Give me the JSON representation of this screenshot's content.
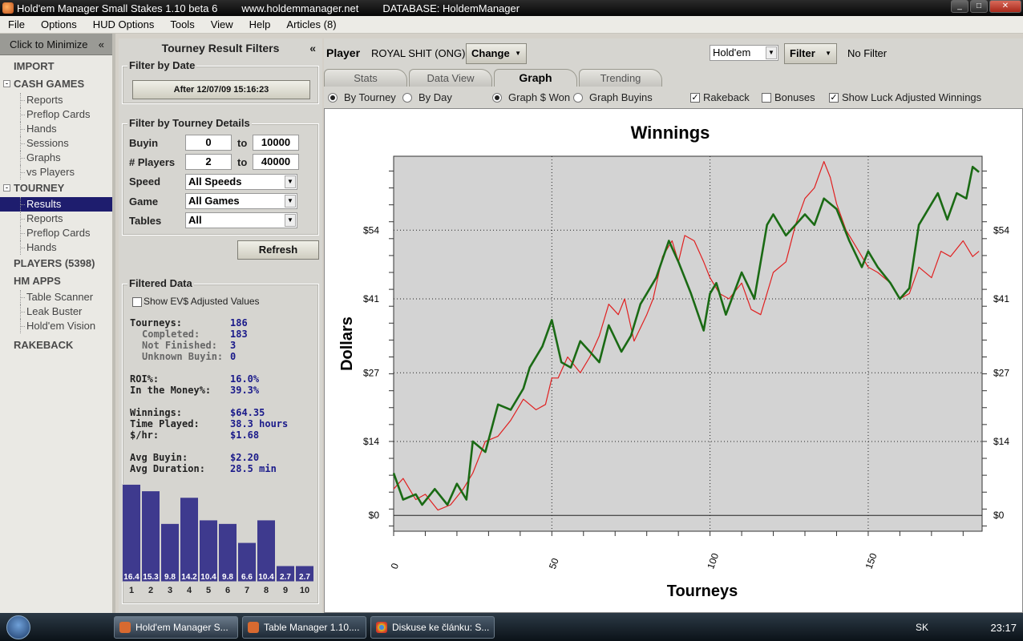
{
  "window": {
    "title": "Hold'em Manager Small Stakes 1.10 beta 6",
    "url": "www.holdemmanager.net",
    "database": "DATABASE: HoldemManager"
  },
  "menu": [
    "File",
    "Options",
    "HUD Options",
    "Tools",
    "View",
    "Help",
    "Articles (8)"
  ],
  "nav": {
    "minimize_label": "Click to Minimize",
    "minimize_arrow": "«",
    "import": "IMPORT",
    "cash_games": "CASH GAMES",
    "cash_items": [
      "Reports",
      "Preflop Cards",
      "Hands",
      "Sessions",
      "Graphs",
      "vs Players"
    ],
    "tourney": "TOURNEY",
    "tourney_items": [
      "Results",
      "Reports",
      "Preflop Cards",
      "Hands"
    ],
    "players": "PLAYERS (5398)",
    "hm_apps": "HM APPS",
    "apps_items": [
      "Table Scanner",
      "Leak Buster",
      "Hold'em Vision"
    ],
    "rakeback": "RAKEBACK",
    "toggle_open": "-"
  },
  "filters": {
    "title": "Tourney Result Filters",
    "collapse": "«",
    "by_date": "Filter by Date",
    "date_button": "After 12/07/09 15:16:23",
    "by_details": "Filter by Tourney Details",
    "buyin_label": "Buyin",
    "buyin_from": "0",
    "buyin_to": "10000",
    "to": "to",
    "players_label": "# Players",
    "players_from": "2",
    "players_to": "40000",
    "speed_label": "Speed",
    "speed_value": "All Speeds",
    "game_label": "Game",
    "game_value": "All Games",
    "tables_label": "Tables",
    "tables_value": "All",
    "refresh": "Refresh"
  },
  "filtered": {
    "title": "Filtered Data",
    "ev_label": "Show EV$ Adjusted Values",
    "stats": [
      {
        "label": "Tourneys:",
        "value": "186",
        "sub": false
      },
      {
        "label": "Completed:",
        "value": "183",
        "sub": true
      },
      {
        "label": "Not Finished:",
        "value": "3",
        "sub": true
      },
      {
        "label": "Unknown Buyin:",
        "value": "0",
        "sub": true
      },
      {
        "label": "ROI%:",
        "value": "16.0%",
        "sub": false,
        "gap": true
      },
      {
        "label": "In the Money%:",
        "value": "39.3%",
        "sub": false
      },
      {
        "label": "Winnings:",
        "value": "$64.35",
        "sub": false,
        "gap": true
      },
      {
        "label": "Time Played:",
        "value": "38.3 hours",
        "sub": false
      },
      {
        "label": "$/hr:",
        "value": "$1.68",
        "sub": false
      },
      {
        "label": "Avg Buyin:",
        "value": "$2.20",
        "sub": false,
        "gap": true
      },
      {
        "label": "Avg Duration:",
        "value": "28.5 min",
        "sub": false
      }
    ],
    "histogram": {
      "labels": [
        "1",
        "2",
        "3",
        "4",
        "5",
        "6",
        "7",
        "8",
        "9",
        "10"
      ],
      "values": [
        16.4,
        15.3,
        9.8,
        14.2,
        10.4,
        9.8,
        6.6,
        10.4,
        2.7,
        2.7
      ],
      "value_labels": [
        "16.4",
        "15.3",
        "9.8",
        "14.2",
        "10.4",
        "9.8",
        "6.6",
        "10.4",
        "2.7",
        "2.7"
      ],
      "max": 17,
      "color": "#3e3a8e"
    }
  },
  "player_bar": {
    "label": "Player",
    "name": "ROYAL SHIT (ONG)",
    "change": "Change",
    "game": "Hold'em",
    "filter": "Filter",
    "no_filter": "No Filter"
  },
  "tabs": [
    {
      "label": "Stats"
    },
    {
      "label": "Data View"
    },
    {
      "label": "Graph",
      "active": true
    },
    {
      "label": "Trending"
    }
  ],
  "options": {
    "by_tourney": "By Tourney",
    "by_day": "By Day",
    "graph_won": "Graph $ Won",
    "graph_buyins": "Graph Buyins",
    "rakeback": "Rakeback",
    "bonuses": "Bonuses",
    "luck": "Show Luck Adjusted Winnings"
  },
  "chart_data": {
    "type": "line",
    "title": "Winnings",
    "xlabel": "Tourneys",
    "ylabel": "Dollars",
    "xlim": [
      0,
      186
    ],
    "ylim": [
      -3,
      68
    ],
    "xticks": [
      0,
      50,
      100,
      150
    ],
    "yticks": [
      {
        "v": 0,
        "l": "$0"
      },
      {
        "v": 14,
        "l": "$14"
      },
      {
        "v": 27,
        "l": "$27"
      },
      {
        "v": 41,
        "l": "$41"
      },
      {
        "v": 54,
        "l": "$54"
      }
    ],
    "grid": "dotted",
    "series": [
      {
        "color": "#1a6a14",
        "x": [
          0,
          3,
          7,
          9,
          13,
          17,
          20,
          23,
          25,
          29,
          33,
          37,
          41,
          43,
          47,
          50,
          53,
          56,
          59,
          62,
          65,
          68,
          72,
          75,
          78,
          80,
          83,
          87,
          90,
          94,
          98,
          100,
          102,
          105,
          110,
          114,
          118,
          120,
          124,
          127,
          130,
          133,
          136,
          140,
          144,
          148,
          150,
          153,
          157,
          160,
          163,
          166,
          169,
          172,
          175,
          178,
          181,
          183,
          185
        ],
        "y": [
          8,
          3,
          4,
          2,
          5,
          2,
          6,
          3,
          14,
          12,
          21,
          20,
          24,
          28,
          32,
          37,
          29,
          28,
          33,
          31,
          29,
          36,
          31,
          34,
          40,
          42,
          45,
          52,
          48,
          42,
          35,
          42,
          44,
          38,
          46,
          41,
          55,
          57,
          53,
          55,
          57,
          55,
          60,
          58,
          52,
          47,
          50,
          47,
          44,
          41,
          43,
          55,
          58,
          61,
          56,
          61,
          60,
          66,
          65
        ]
      },
      {
        "color": "#e02020",
        "x": [
          0,
          3,
          7,
          10,
          14,
          18,
          22,
          25,
          29,
          33,
          37,
          41,
          45,
          48,
          50,
          52,
          55,
          59,
          62,
          65,
          68,
          71,
          73,
          76,
          80,
          82,
          85,
          88,
          90,
          92,
          95,
          98,
          100,
          103,
          106,
          110,
          113,
          116,
          120,
          124,
          127,
          130,
          133,
          136,
          138,
          140,
          143,
          147,
          150,
          153,
          157,
          160,
          163,
          166,
          170,
          173,
          176,
          180,
          183,
          185
        ],
        "y": [
          5,
          7,
          3,
          4,
          1,
          2,
          5,
          8,
          14,
          15,
          18,
          22,
          20,
          21,
          26,
          26,
          30,
          27,
          30,
          34,
          40,
          38,
          41,
          33,
          38,
          41,
          49,
          52,
          48,
          53,
          52,
          48,
          45,
          42,
          41,
          44,
          39,
          38,
          46,
          48,
          55,
          60,
          62,
          67,
          64,
          59,
          54,
          50,
          47,
          46,
          44,
          41,
          42,
          47,
          45,
          50,
          49,
          52,
          49,
          50
        ]
      }
    ]
  }
}
